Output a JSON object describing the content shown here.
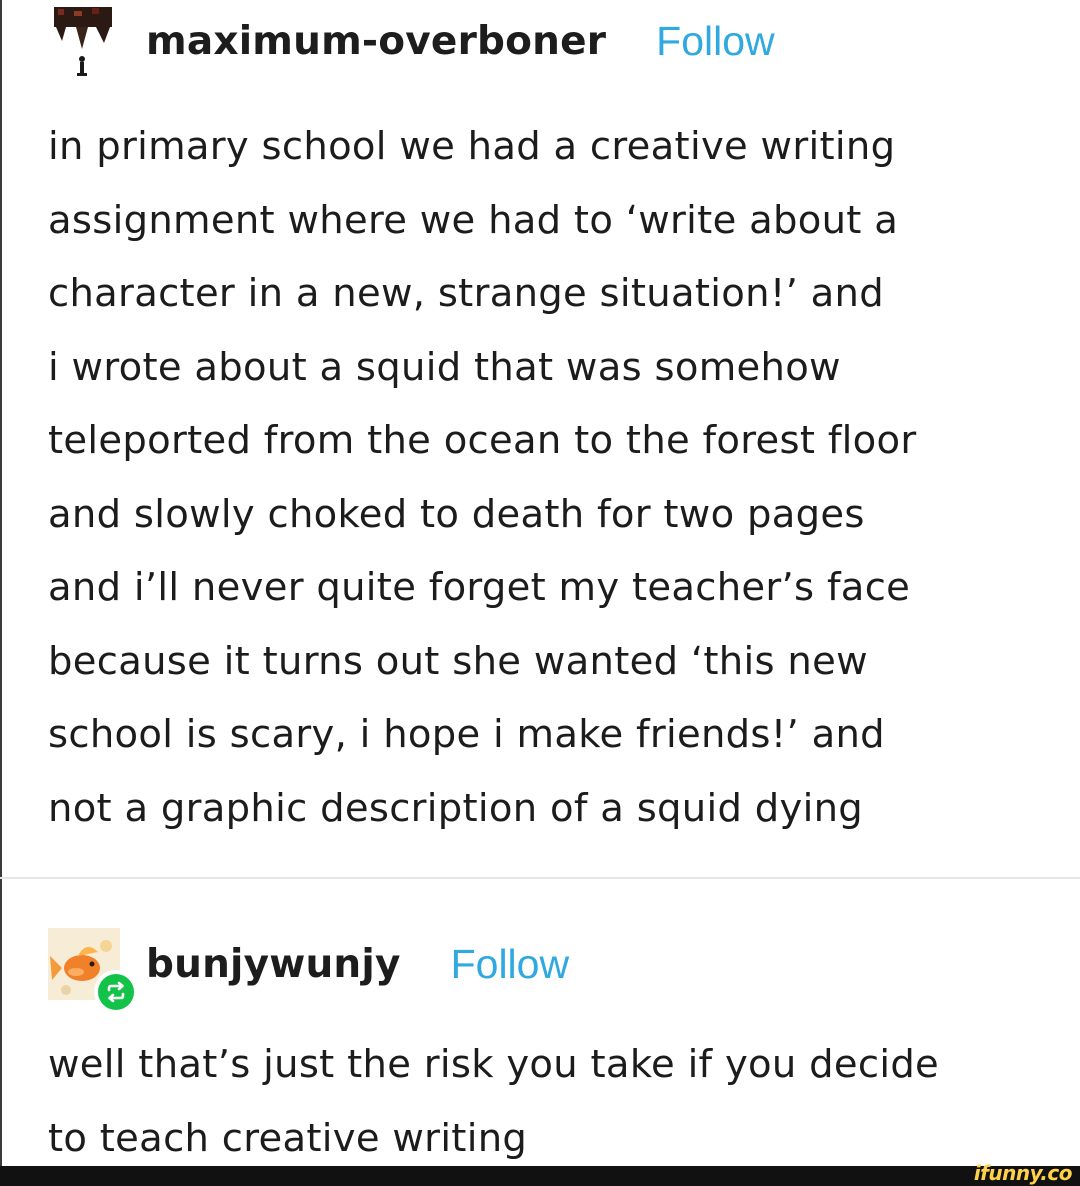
{
  "posts": [
    {
      "username": "maximum-overboner",
      "follow_label": "Follow",
      "avatar_icon": "dark-figure-avatar",
      "lines": [
        "in primary school we had a creative writing",
        "assignment where we had to ‘write about a",
        "character in a new, strange situation!’ and",
        "i wrote about a squid that was somehow",
        "teleported from the ocean to the forest floor",
        "and slowly choked to death for two pages",
        "and i’ll never quite forget my teacher’s face",
        "because it turns out she wanted ‘this new",
        "school is scary, i hope i make friends!’ and",
        "not a graphic description of a squid dying"
      ]
    },
    {
      "username": "bunjywunjy",
      "follow_label": "Follow",
      "avatar_icon": "goldfish-avatar",
      "badge_icon": "reblog-icon",
      "lines": [
        "well that’s just the risk you take if you decide",
        "to teach creative writing"
      ]
    }
  ],
  "watermark": "ifunny.co",
  "colors": {
    "follow": "#2fa9e0",
    "reblog_badge": "#13c249",
    "text": "#1c1c1c",
    "footer": "#111111",
    "watermark": "#ffd24a"
  }
}
